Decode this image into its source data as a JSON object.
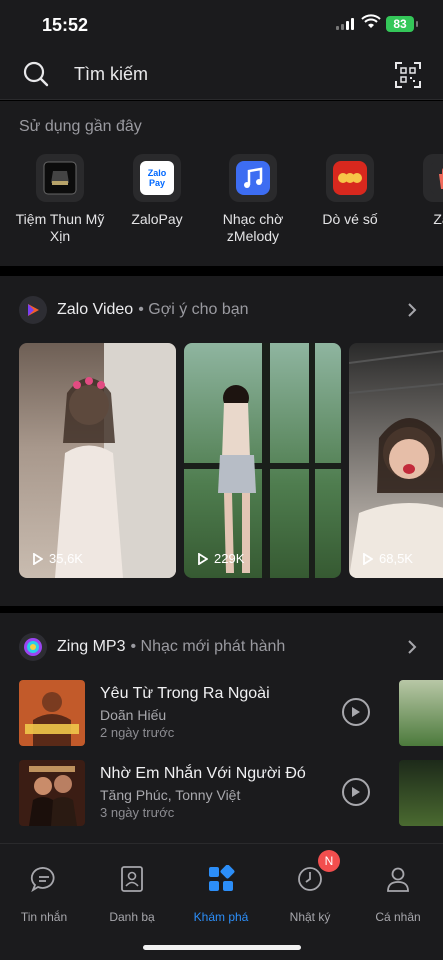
{
  "status_bar": {
    "time": "15:52",
    "battery": "83"
  },
  "search": {
    "placeholder": "Tìm kiếm"
  },
  "recent": {
    "label": "Sử dụng gần đây",
    "apps": [
      {
        "name": "Tiệm Thun Mỹ Xịn",
        "icon": "shop-logo-icon"
      },
      {
        "name": "ZaloPay",
        "icon": "zalopay-icon",
        "logo_text": "Zalo Pay"
      },
      {
        "name": "Nhạc chờ zMelody",
        "icon": "music-note-icon"
      },
      {
        "name": "Dò vé số",
        "icon": "lottery-icon"
      },
      {
        "name": "Zalo",
        "icon": "shopping-bag-icon"
      }
    ]
  },
  "video": {
    "title": "Zalo Video",
    "subtitle": "• Gợi ý cho bạn",
    "cards": [
      {
        "views": "35,6K"
      },
      {
        "views": "229K"
      },
      {
        "views": "68,5K"
      }
    ]
  },
  "mp3": {
    "title": "Zing MP3",
    "subtitle": "• Nhạc mới phát hành",
    "songs": [
      {
        "title": "Yêu Từ Trong Ra Ngoài",
        "artist": "Doãn Hiếu",
        "date": "2 ngày trước"
      },
      {
        "title": "Nhờ Em Nhắn Với Người Đó",
        "artist": "Tăng Phúc, Tonny Việt",
        "date": "3 ngày trước"
      }
    ]
  },
  "nav": {
    "tabs": [
      {
        "label": "Tin nhắn",
        "icon": "chat-bubble-icon"
      },
      {
        "label": "Danh bạ",
        "icon": "contacts-icon"
      },
      {
        "label": "Khám phá",
        "icon": "discover-grid-icon",
        "active": true
      },
      {
        "label": "Nhật ký",
        "icon": "clock-icon",
        "badge": "N"
      },
      {
        "label": "Cá nhân",
        "icon": "person-icon"
      }
    ]
  },
  "colors": {
    "accent": "#2c8ef8",
    "background": "#1b1b1d",
    "badge": "#f24e4e",
    "battery": "#34c759"
  }
}
